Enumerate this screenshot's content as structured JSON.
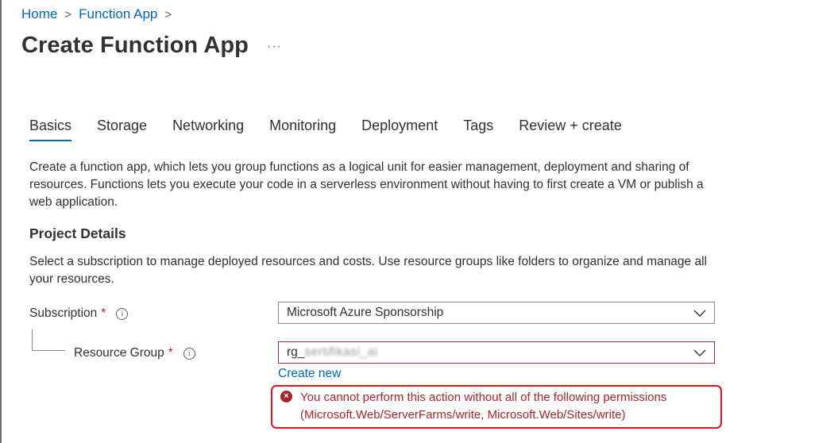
{
  "breadcrumb": {
    "items": [
      "Home",
      "Function App"
    ],
    "separator": ">"
  },
  "page": {
    "title": "Create Function App",
    "more_label": "···"
  },
  "tabs": [
    {
      "label": "Basics",
      "active": true
    },
    {
      "label": "Storage",
      "active": false
    },
    {
      "label": "Networking",
      "active": false
    },
    {
      "label": "Monitoring",
      "active": false
    },
    {
      "label": "Deployment",
      "active": false
    },
    {
      "label": "Tags",
      "active": false
    },
    {
      "label": "Review + create",
      "active": false
    }
  ],
  "intro": {
    "text": "Create a function app, which lets you group functions as a logical unit for easier management, deployment and sharing of resources. Functions lets you execute your code in a serverless environment without having to first create a VM or publish a web application."
  },
  "project_details": {
    "title": "Project Details",
    "description": "Select a subscription to manage deployed resources and costs. Use resource groups like folders to organize and manage all your resources."
  },
  "fields": {
    "subscription": {
      "label": "Subscription",
      "required_mark": "*",
      "info_icon": "i",
      "value": "Microsoft Azure Sponsorship"
    },
    "resource_group": {
      "label": "Resource Group",
      "required_mark": "*",
      "info_icon": "i",
      "value_visible": "rg_",
      "value_blurred": "sertifikasi_ai",
      "create_new_label": "Create new"
    }
  },
  "error": {
    "icon": "×",
    "message": "You cannot perform this action without all of the following permissions (Microsoft.Web/ServerFarms/write, Microsoft.Web/Sites/write)"
  },
  "colors": {
    "link": "#0067b8",
    "error": "#a4262c",
    "error_border": "#e81123",
    "focus_border": "#8a2e6b"
  }
}
